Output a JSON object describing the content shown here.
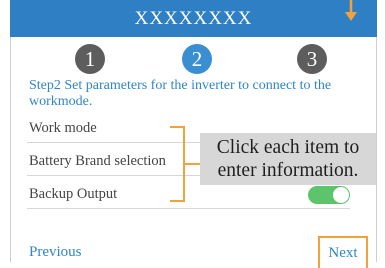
{
  "header": {
    "title": "XXXXXXXX"
  },
  "steps": [
    {
      "number": "1",
      "state": "inactive"
    },
    {
      "number": "2",
      "state": "active"
    },
    {
      "number": "3",
      "state": "inactive"
    }
  ],
  "instruction": "Step2 Set parameters for the inverter to connect to the workmode.",
  "items": [
    {
      "label": "Work mode"
    },
    {
      "label": "Battery Brand selection"
    },
    {
      "label": "Backup Output",
      "toggle_on": true
    }
  ],
  "annotation": {
    "line1": "Click each item to",
    "line2": "enter information."
  },
  "footer": {
    "previous_label": "Previous",
    "next_label": "Next"
  },
  "colors": {
    "header_bg": "#2f7fc4",
    "accent_text": "#2f85c7",
    "step_active": "#3a8fd3",
    "step_inactive": "#5d5d5d",
    "annotation_orange": "#f2a23a",
    "toggle_on": "#5cc46b"
  }
}
